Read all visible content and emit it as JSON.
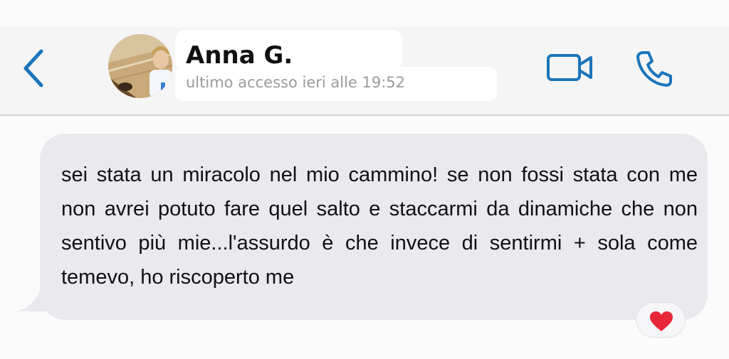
{
  "header": {
    "contact_name": "Anna G.",
    "last_seen": "ultimo accesso ieri alle 19:52",
    "icons": {
      "back": "chevron-left-icon",
      "video": "video-camera-icon",
      "phone": "phone-icon"
    }
  },
  "message": {
    "text": "sei stata un miracolo nel mio cammino! se non fossi stata con me non avrei potuto fare quel salto e staccarmi da dinamiche che non sentivo più mie...l'assurdo è che invece di sentirmi + sola come temevo, ho riscoperto me",
    "reaction_icon": "heart-icon"
  },
  "colors": {
    "accent": "#1b75bb",
    "bubble": "#e9e9ee",
    "reaction_heart": "#e8263a",
    "secondary_text": "#9a9a9a"
  }
}
